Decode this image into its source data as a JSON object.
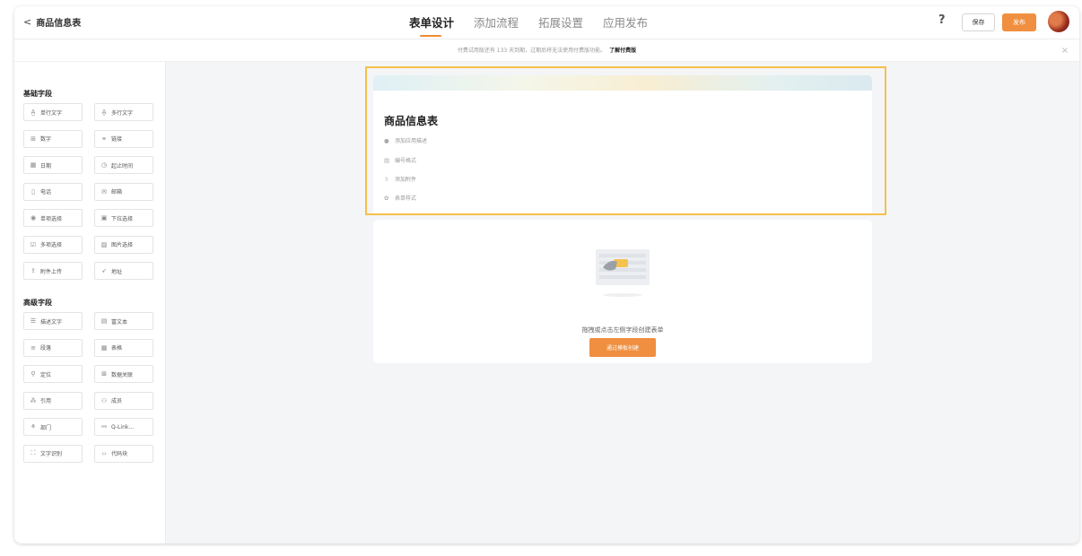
{
  "header": {
    "back_label": "商品信息表",
    "tabs": [
      {
        "label": "表单设计",
        "active": true
      },
      {
        "label": "添加流程",
        "active": false
      },
      {
        "label": "拓展设置",
        "active": false
      },
      {
        "label": "应用发布",
        "active": false
      }
    ],
    "help_label": "?",
    "save_label": "保存",
    "publish_label": "发布"
  },
  "notice": {
    "text": "付费试用版还有 133 天到期，过期后将无法使用付费版功能。",
    "link_label": "了解付费版",
    "close_label": "×"
  },
  "sidebar": {
    "basic_title": "基础字段",
    "basic_fields": [
      {
        "label": "单行文字",
        "icon": "single-line-text-icon",
        "glyph": "A̲"
      },
      {
        "label": "多行文字",
        "icon": "multi-line-text-icon",
        "glyph": "A͇"
      },
      {
        "label": "数字",
        "icon": "number-icon",
        "glyph": "⊞"
      },
      {
        "label": "链接",
        "icon": "link-icon",
        "glyph": "⚭"
      },
      {
        "label": "日期",
        "icon": "date-icon",
        "glyph": "▦"
      },
      {
        "label": "起止时间",
        "icon": "time-range-icon",
        "glyph": "◷"
      },
      {
        "label": "电话",
        "icon": "phone-icon",
        "glyph": "▯"
      },
      {
        "label": "邮箱",
        "icon": "mail-icon",
        "glyph": "✉"
      },
      {
        "label": "单项选择",
        "icon": "radio-icon",
        "glyph": "◉"
      },
      {
        "label": "下拉选择",
        "icon": "dropdown-icon",
        "glyph": "▣"
      },
      {
        "label": "多项选择",
        "icon": "checkbox-icon",
        "glyph": "☑"
      },
      {
        "label": "图片选择",
        "icon": "image-select-icon",
        "glyph": "▨"
      },
      {
        "label": "附件上传",
        "icon": "upload-icon",
        "glyph": "⇪"
      },
      {
        "label": "地址",
        "icon": "location-icon",
        "glyph": "➶"
      }
    ],
    "advanced_title": "高级字段",
    "advanced_fields": [
      {
        "label": "描述文字",
        "icon": "description-icon",
        "glyph": "☰"
      },
      {
        "label": "富文本",
        "icon": "rich-text-icon",
        "glyph": "▤"
      },
      {
        "label": "段落",
        "icon": "paragraph-icon",
        "glyph": "≡"
      },
      {
        "label": "表格",
        "icon": "table-icon",
        "glyph": "▦"
      },
      {
        "label": "定位",
        "icon": "locate-icon",
        "glyph": "⚲"
      },
      {
        "label": "数据关联",
        "icon": "data-link-icon",
        "glyph": "⊠"
      },
      {
        "label": "引用",
        "icon": "quote-icon",
        "glyph": "⁂"
      },
      {
        "label": "成员",
        "icon": "member-icon",
        "glyph": "⚇"
      },
      {
        "label": "部门",
        "icon": "department-icon",
        "glyph": "⚘"
      },
      {
        "label": "Q-Link...",
        "icon": "qlink-icon",
        "glyph": "⚯"
      },
      {
        "label": "文字识别",
        "icon": "ocr-icon",
        "glyph": "⛶"
      },
      {
        "label": "代码块",
        "icon": "code-icon",
        "glyph": "‹›"
      }
    ]
  },
  "form": {
    "title": "商品信息表",
    "options": [
      {
        "label": "添加应用描述",
        "icon": "comment-icon",
        "glyph": "●"
      },
      {
        "label": "编号格式",
        "icon": "number-format-icon",
        "glyph": "▤"
      },
      {
        "label": "添加附件",
        "icon": "attachment-icon",
        "glyph": "⇧"
      },
      {
        "label": "表单样式",
        "icon": "style-icon",
        "glyph": "✿"
      }
    ]
  },
  "empty_state": {
    "text": "拖拽或点击左侧字段创建表单",
    "button_label": "通过模板创建"
  },
  "colors": {
    "accent": "#ef8f3f",
    "highlight_border": "#f5c04a"
  }
}
